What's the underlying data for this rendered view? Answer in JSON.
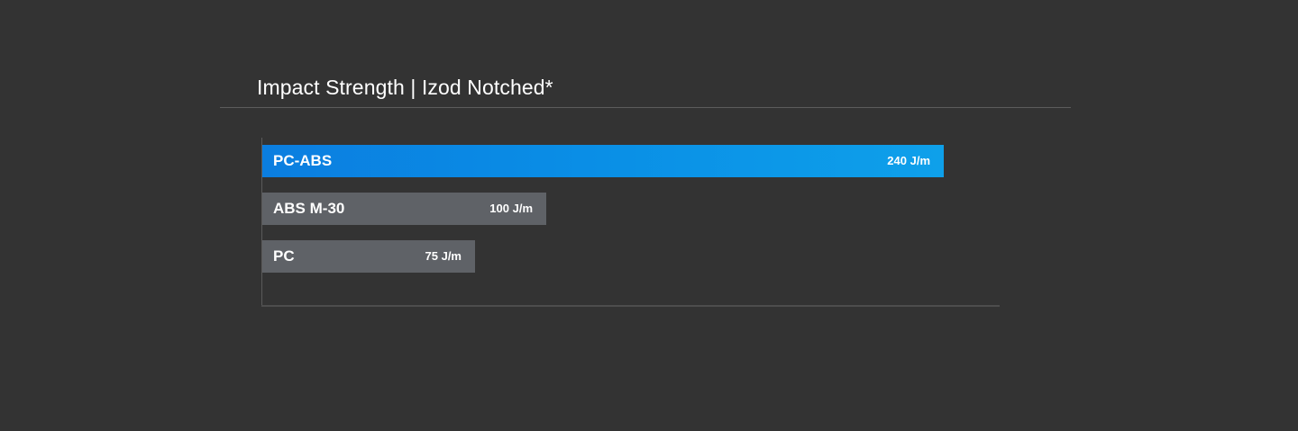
{
  "chart_data": {
    "type": "bar",
    "orientation": "horizontal",
    "title": "Impact Strength | Izod Notched*",
    "xlabel": "",
    "ylabel": "",
    "unit": "J/m",
    "xlim": [
      0,
      260
    ],
    "grid": false,
    "highlight_color": "#0b84e2",
    "bar_color": "#5f6267",
    "background_color": "#333333",
    "bars": [
      {
        "category": "PC-ABS",
        "value": 240,
        "value_label": "240 J/m",
        "highlight": true
      },
      {
        "category": "ABS M-30",
        "value": 100,
        "value_label": "100 J/m",
        "highlight": false
      },
      {
        "category": "PC",
        "value": 75,
        "value_label": "75 J/m",
        "highlight": false
      }
    ]
  }
}
